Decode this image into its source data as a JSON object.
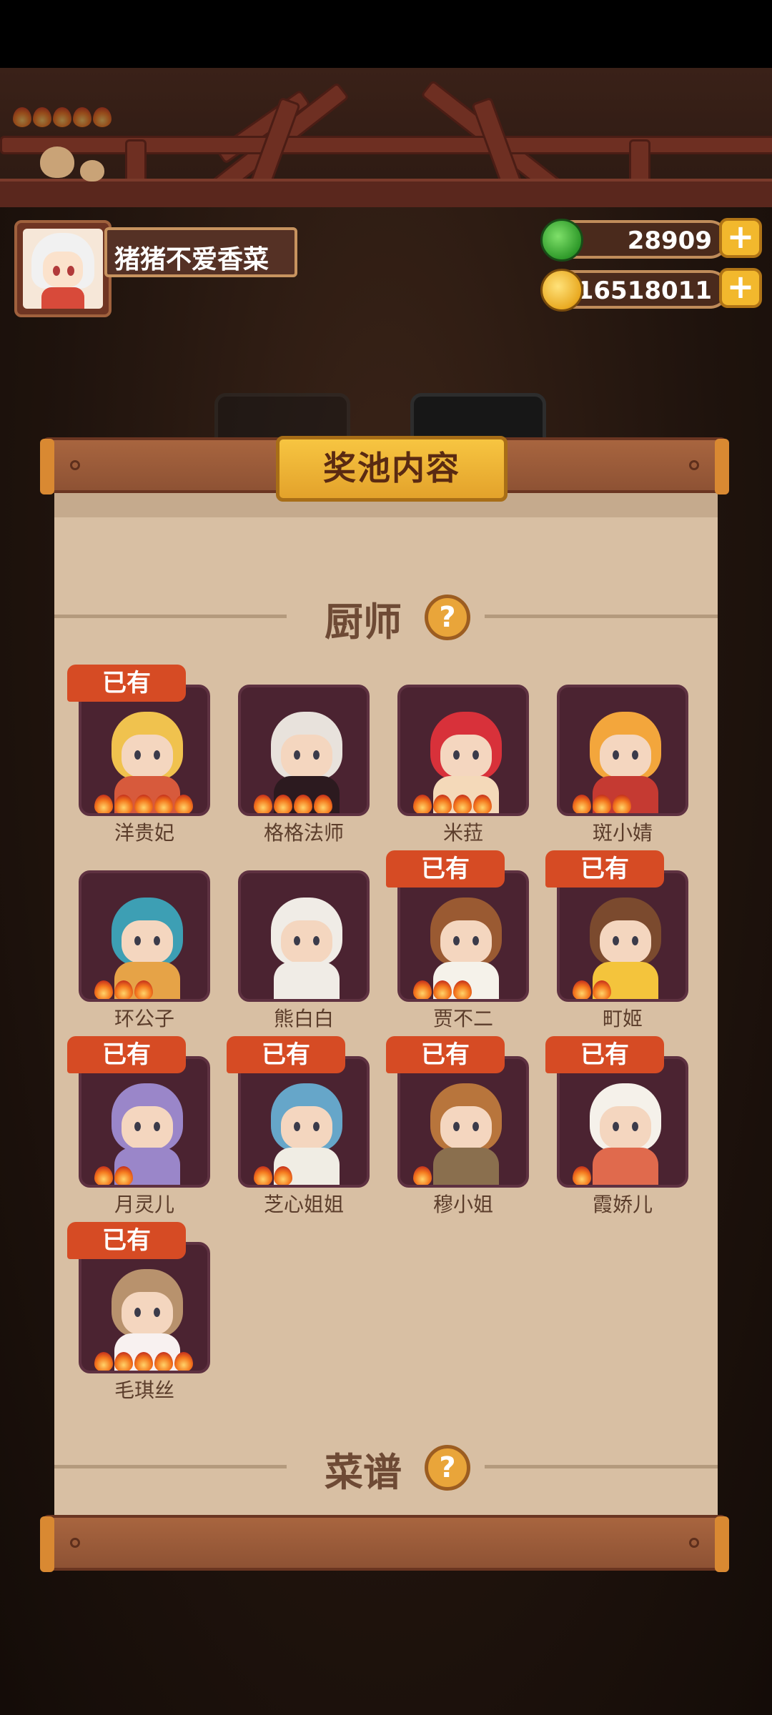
{
  "user": {
    "name": "猪猪不爱香菜"
  },
  "currency": {
    "jade": {
      "value": "28909",
      "icon": "jade-icon"
    },
    "coins": {
      "value": "16518011",
      "icon": "coin-icon"
    },
    "plus_label": "+"
  },
  "panel": {
    "title": "奖池内容",
    "sections": {
      "chefs": "厨师",
      "recipes": "菜谱"
    },
    "help_label": "?",
    "owned_label": "已有"
  },
  "chefs": [
    {
      "name": "洋贵妃",
      "owned": true,
      "stars": 5,
      "hair": "#f0c24e",
      "outfit": "#d75a3c"
    },
    {
      "name": "格格法师",
      "owned": false,
      "stars": 4,
      "hair": "#e8e2dc",
      "outfit": "#2c1a1f"
    },
    {
      "name": "米菈",
      "owned": false,
      "stars": 4,
      "hair": "#d8313a",
      "outfit": "#f4d9b9"
    },
    {
      "name": "斑小婧",
      "owned": false,
      "stars": 3,
      "hair": "#f3a63c",
      "outfit": "#c53a32"
    },
    {
      "name": "环公子",
      "owned": false,
      "stars": 3,
      "hair": "#3d9fb4",
      "outfit": "#e6a347"
    },
    {
      "name": "熊白白",
      "owned": false,
      "stars": 0,
      "hair": "#f0ece6",
      "outfit": "#f0ece6"
    },
    {
      "name": "贾不二",
      "owned": true,
      "stars": 3,
      "hair": "#9a5a32",
      "outfit": "#f5f2ea"
    },
    {
      "name": "町姬",
      "owned": true,
      "stars": 2,
      "hair": "#7b4a2e",
      "outfit": "#f4c43c"
    },
    {
      "name": "月灵儿",
      "owned": true,
      "stars": 2,
      "hair": "#9a86c9",
      "outfit": "#9a86c9"
    },
    {
      "name": "芝心姐姐",
      "owned": true,
      "stars": 2,
      "hair": "#66a6c9",
      "outfit": "#f0ede4"
    },
    {
      "name": "穆小姐",
      "owned": true,
      "stars": 1,
      "hair": "#b8753c",
      "outfit": "#8a6f4e"
    },
    {
      "name": "霞娇儿",
      "owned": true,
      "stars": 1,
      "hair": "#f5f1ea",
      "outfit": "#e06a4d"
    },
    {
      "name": "毛琪丝",
      "owned": true,
      "stars": 5,
      "hair": "#b8926d",
      "outfit": "#f8f1f0"
    }
  ]
}
